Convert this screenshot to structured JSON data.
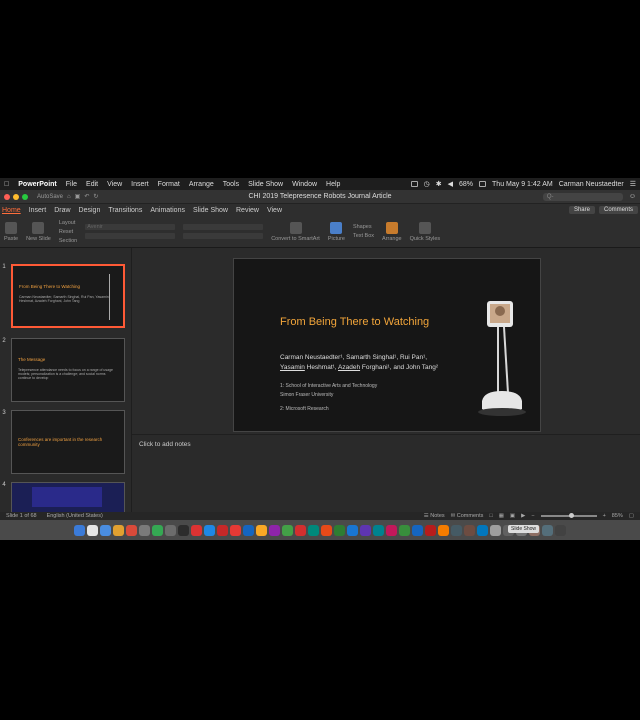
{
  "menubar": {
    "app": "PowerPoint",
    "menus": [
      "File",
      "Edit",
      "View",
      "Insert",
      "Format",
      "Arrange",
      "Tools",
      "Slide Show",
      "Window",
      "Help"
    ],
    "battery": "68%",
    "clock": "Thu May 9  1:42 AM",
    "user": "Carman Neustaedter"
  },
  "window": {
    "title": "CHI 2019 Telepresence Robots Journal Article",
    "autosave": "AutoSave",
    "search_placeholder": "Q-"
  },
  "ribbon": {
    "tabs": [
      "Home",
      "Insert",
      "Draw",
      "Design",
      "Transitions",
      "Animations",
      "Slide Show",
      "Review",
      "View"
    ],
    "active_tab": "Home",
    "share": "Share",
    "comments": "Comments",
    "paste": "Paste",
    "new_slide": "New Slide",
    "layout": "Layout",
    "reset": "Reset",
    "section": "Section",
    "font_name": "Avenir",
    "convert": "Convert to SmartArt",
    "picture": "Picture",
    "shapes": "Shapes",
    "textbox": "Text Box",
    "arrange": "Arrange",
    "quick_styles": "Quick Styles"
  },
  "thumbnails": [
    {
      "num": "1",
      "title": "From Being There to Watching",
      "body": "Carman Neustaedter, Samarth Singhal, Rui Pan, Yasamin Heshmat, Azadeh Forghani, John Tang",
      "selected": true
    },
    {
      "num": "2",
      "title": "The Message",
      "body": "Telepresence attendance needs to focus on a range of usage models; personalization is a challenge; and social norms continue to develop",
      "selected": false
    },
    {
      "num": "3",
      "title": "Conferences are important in the research community",
      "body": "",
      "selected": false
    },
    {
      "num": "4",
      "title": "",
      "body": "",
      "selected": false
    }
  ],
  "slide": {
    "title": "From Being There to Watching",
    "authors_line1": "Carman Neustaedter¹, Samarth Singhal¹, Rui Pan¹,",
    "authors_line2_a": "Yasamin",
    "authors_line2_b": " Heshmat¹, ",
    "authors_line2_c": "Azadeh",
    "authors_line2_d": " Forghani¹, and John Tang²",
    "aff1": "1: School of Interactive Arts and Technology",
    "aff2": "Simon Fraser University",
    "aff3": "2: Microsoft Research"
  },
  "notes": {
    "placeholder": "Click to add notes"
  },
  "status": {
    "slide": "Slide 1 of 68",
    "language": "English (United States)",
    "notes": "Notes",
    "comments": "Comments",
    "zoom": "85%",
    "zoom_level": 0.55
  },
  "dock": {
    "tooltip": "Slide Show",
    "icon_colors": [
      "#3b7bd8",
      "#e6e6e6",
      "#4a8de0",
      "#e0a030",
      "#d94a3a",
      "#7a7a7a",
      "#35a853",
      "#6c6c6c",
      "#2c2c2c",
      "#d33",
      "#1e88e5",
      "#c62828",
      "#e53935",
      "#1565c0",
      "#f9a825",
      "#8e24aa",
      "#43a047",
      "#d32f2f",
      "#00897b",
      "#e64a19",
      "#2e7d32",
      "#1976d2",
      "#5e35b1",
      "#00838f",
      "#c2185b",
      "#388e3c",
      "#1565c0",
      "#b71c1c",
      "#f57c00",
      "#455a64",
      "#6d4c41",
      "#0277bd",
      "#9e9e9e",
      "#616161",
      "#757575",
      "#8d6e63",
      "#546e7a",
      "#424242"
    ]
  }
}
